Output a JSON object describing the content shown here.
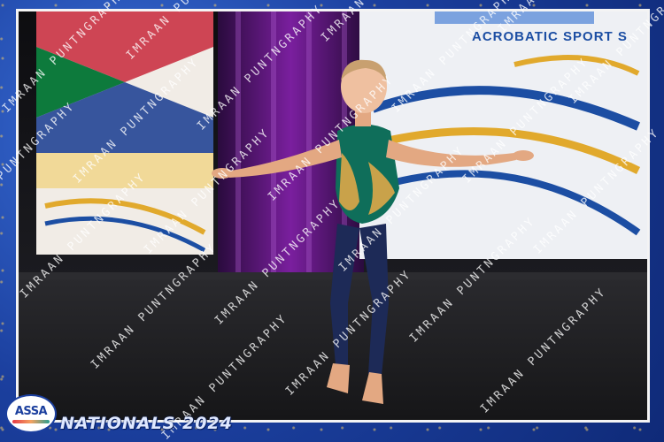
{
  "photo": {
    "banner_text": "ACROBATIC SPORT S",
    "subject": "young-acrobatic-gymnast-performing-on-stage"
  },
  "watermark": {
    "text": "IMRAAN PUNTNGRAPHY"
  },
  "branding": {
    "logo_text": "ASSA",
    "event_title": "NATIONALS 2024"
  },
  "colors": {
    "frame_blue": "#1b3f9e",
    "leotard_green": "#0f6e5a",
    "leotard_gold": "#c9a24a",
    "tights_navy": "#1d2a57"
  }
}
